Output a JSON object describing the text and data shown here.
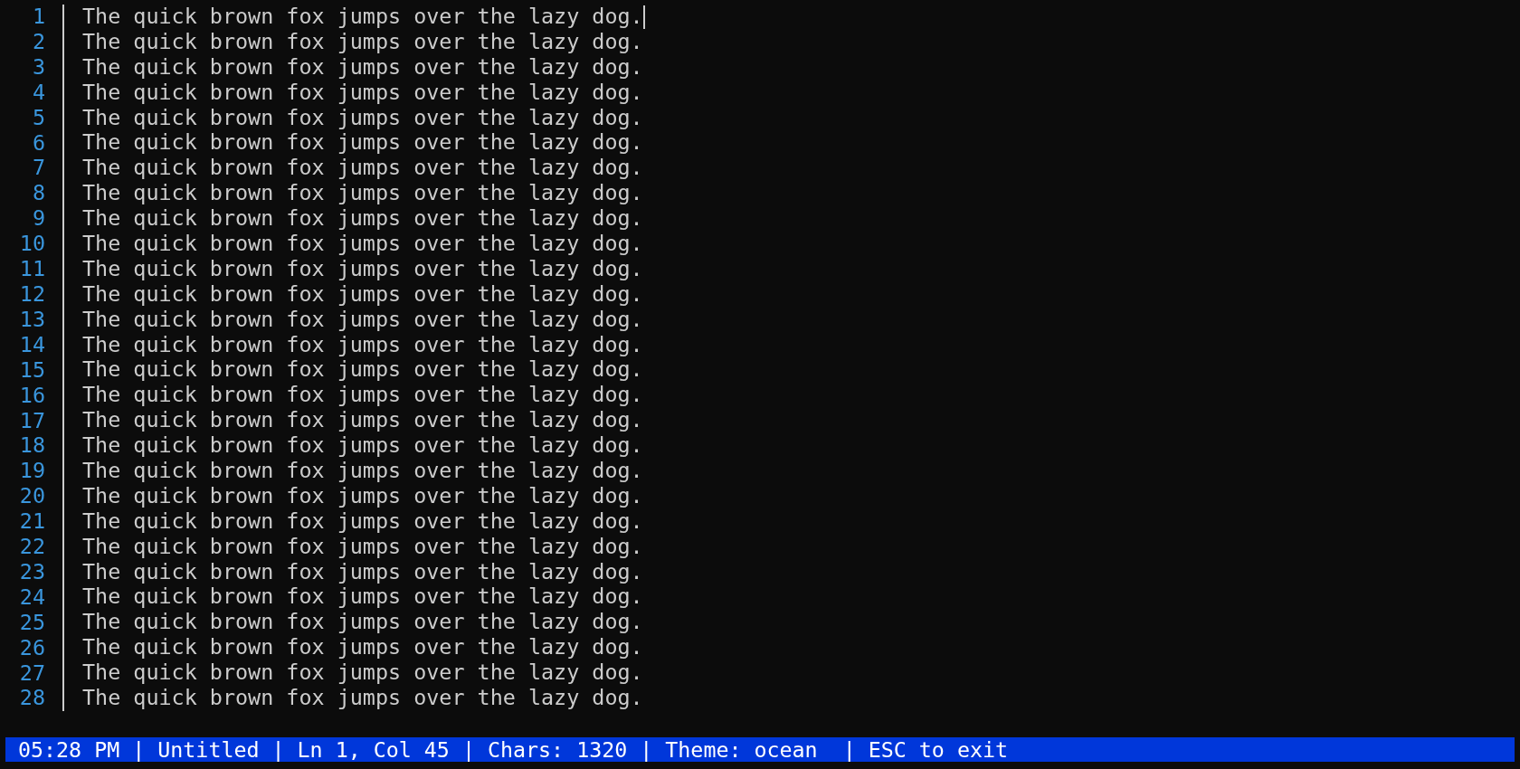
{
  "lines": [
    {
      "number": "1",
      "text": "The quick brown fox jumps over the lazy dog.",
      "cursor": true
    },
    {
      "number": "2",
      "text": "The quick brown fox jumps over the lazy dog.",
      "cursor": false
    },
    {
      "number": "3",
      "text": "The quick brown fox jumps over the lazy dog.",
      "cursor": false
    },
    {
      "number": "4",
      "text": "The quick brown fox jumps over the lazy dog.",
      "cursor": false
    },
    {
      "number": "5",
      "text": "The quick brown fox jumps over the lazy dog.",
      "cursor": false
    },
    {
      "number": "6",
      "text": "The quick brown fox jumps over the lazy dog.",
      "cursor": false
    },
    {
      "number": "7",
      "text": "The quick brown fox jumps over the lazy dog.",
      "cursor": false
    },
    {
      "number": "8",
      "text": "The quick brown fox jumps over the lazy dog.",
      "cursor": false
    },
    {
      "number": "9",
      "text": "The quick brown fox jumps over the lazy dog.",
      "cursor": false
    },
    {
      "number": "10",
      "text": "The quick brown fox jumps over the lazy dog.",
      "cursor": false
    },
    {
      "number": "11",
      "text": "The quick brown fox jumps over the lazy dog.",
      "cursor": false
    },
    {
      "number": "12",
      "text": "The quick brown fox jumps over the lazy dog.",
      "cursor": false
    },
    {
      "number": "13",
      "text": "The quick brown fox jumps over the lazy dog.",
      "cursor": false
    },
    {
      "number": "14",
      "text": "The quick brown fox jumps over the lazy dog.",
      "cursor": false
    },
    {
      "number": "15",
      "text": "The quick brown fox jumps over the lazy dog.",
      "cursor": false
    },
    {
      "number": "16",
      "text": "The quick brown fox jumps over the lazy dog.",
      "cursor": false
    },
    {
      "number": "17",
      "text": "The quick brown fox jumps over the lazy dog.",
      "cursor": false
    },
    {
      "number": "18",
      "text": "The quick brown fox jumps over the lazy dog.",
      "cursor": false
    },
    {
      "number": "19",
      "text": "The quick brown fox jumps over the lazy dog.",
      "cursor": false
    },
    {
      "number": "20",
      "text": "The quick brown fox jumps over the lazy dog.",
      "cursor": false
    },
    {
      "number": "21",
      "text": "The quick brown fox jumps over the lazy dog.",
      "cursor": false
    },
    {
      "number": "22",
      "text": "The quick brown fox jumps over the lazy dog.",
      "cursor": false
    },
    {
      "number": "23",
      "text": "The quick brown fox jumps over the lazy dog.",
      "cursor": false
    },
    {
      "number": "24",
      "text": "The quick brown fox jumps over the lazy dog.",
      "cursor": false
    },
    {
      "number": "25",
      "text": "The quick brown fox jumps over the lazy dog.",
      "cursor": false
    },
    {
      "number": "26",
      "text": "The quick brown fox jumps over the lazy dog.",
      "cursor": false
    },
    {
      "number": "27",
      "text": "The quick brown fox jumps over the lazy dog.",
      "cursor": false
    },
    {
      "number": "28",
      "text": "The quick brown fox jumps over the lazy dog.",
      "cursor": false
    }
  ],
  "status_bar": {
    "text": "05:28 PM | Untitled | Ln 1, Col 45 | Chars: 1320 | Theme: ocean  | ESC to exit"
  }
}
